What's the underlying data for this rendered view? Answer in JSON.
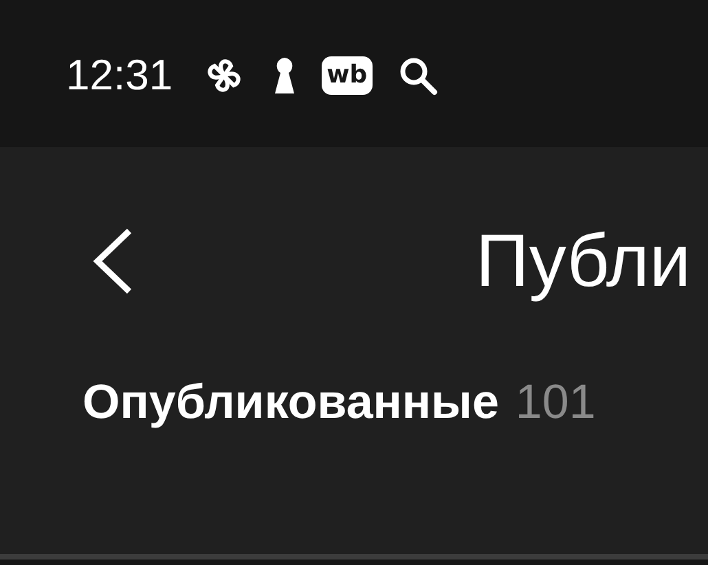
{
  "status_bar": {
    "time": "12:31",
    "badge": "wb"
  },
  "header": {
    "title": "Публи"
  },
  "tabs": [
    {
      "label": "Опубликованные",
      "count": "101",
      "selected": true
    }
  ]
}
